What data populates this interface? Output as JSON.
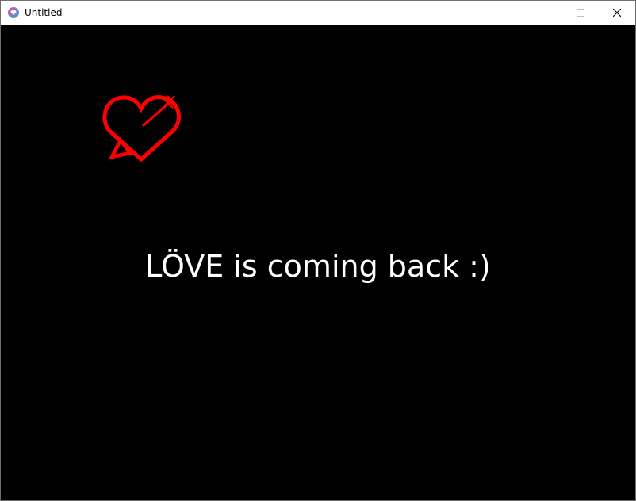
{
  "window": {
    "title": "Untitled",
    "app_icon": "love-heart-icon"
  },
  "controls": {
    "minimize_icon": "minimize-icon",
    "maximize_icon": "maximize-icon",
    "close_icon": "close-icon"
  },
  "canvas": {
    "background_color": "#000000",
    "logo_icon": "heart-arrow-icon",
    "logo_color": "#ff0000",
    "message": "LÖVE is coming back :)",
    "message_color": "#ffffff"
  }
}
